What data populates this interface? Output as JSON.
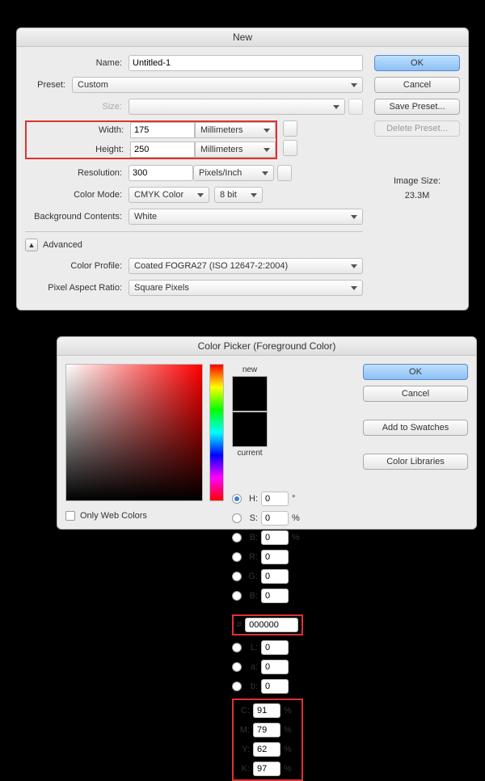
{
  "newDlg": {
    "title": "New",
    "name_lbl": "Name:",
    "name_val": "Untitled-1",
    "preset_lbl": "Preset:",
    "preset_val": "Custom",
    "size_lbl": "Size:",
    "size_val": "",
    "width_lbl": "Width:",
    "width_val": "175",
    "width_unit": "Millimeters",
    "height_lbl": "Height:",
    "height_val": "250",
    "height_unit": "Millimeters",
    "res_lbl": "Resolution:",
    "res_val": "300",
    "res_unit": "Pixels/Inch",
    "mode_lbl": "Color Mode:",
    "mode_val": "CMYK Color",
    "mode_bits": "8 bit",
    "bg_lbl": "Background Contents:",
    "bg_val": "White",
    "adv_lbl": "Advanced",
    "profile_lbl": "Color Profile:",
    "profile_val": "Coated FOGRA27 (ISO 12647-2:2004)",
    "par_lbl": "Pixel Aspect Ratio:",
    "par_val": "Square Pixels",
    "btn_ok": "OK",
    "btn_cancel": "Cancel",
    "btn_save": "Save Preset...",
    "btn_delete": "Delete Preset...",
    "imgsize_lbl": "Image Size:",
    "imgsize_val": "23.3M"
  },
  "cp": {
    "title": "Color Picker (Foreground Color)",
    "new_lbl": "new",
    "current_lbl": "current",
    "btn_ok": "OK",
    "btn_cancel": "Cancel",
    "btn_add": "Add to Swatches",
    "btn_lib": "Color Libraries",
    "only_web": "Only Web Colors",
    "H": {
      "lab": "H:",
      "val": "0",
      "unit": "°"
    },
    "S": {
      "lab": "S:",
      "val": "0",
      "unit": "%"
    },
    "Bh": {
      "lab": "B:",
      "val": "0",
      "unit": "%"
    },
    "R": {
      "lab": "R:",
      "val": "0"
    },
    "G": {
      "lab": "G:",
      "val": "0"
    },
    "B": {
      "lab": "B:",
      "val": "0"
    },
    "L": {
      "lab": "L:",
      "val": "0"
    },
    "a": {
      "lab": "a:",
      "val": "0"
    },
    "b": {
      "lab": "b:",
      "val": "0"
    },
    "C": {
      "lab": "C:",
      "val": "91",
      "unit": "%"
    },
    "M": {
      "lab": "M:",
      "val": "79",
      "unit": "%"
    },
    "Y": {
      "lab": "Y:",
      "val": "62",
      "unit": "%"
    },
    "K": {
      "lab": "K:",
      "val": "97",
      "unit": "%"
    },
    "hex_prefix": "#",
    "hex_val": "000000"
  }
}
